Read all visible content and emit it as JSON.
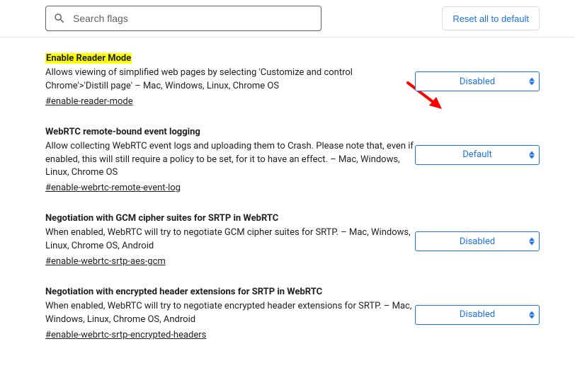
{
  "header": {
    "search_placeholder": "Search flags",
    "reset_label": "Reset all to default"
  },
  "flags": [
    {
      "title": "Enable Reader Mode",
      "highlight": true,
      "description": "Allows viewing of simplified web pages by selecting 'Customize and control Chrome'>'Distill page' – Mac, Windows, Linux, Chrome OS",
      "hash": "#enable-reader-mode",
      "select_value": "Disabled"
    },
    {
      "title": "WebRTC remote-bound event logging",
      "highlight": false,
      "description": "Allow collecting WebRTC event logs and uploading them to Crash. Please note that, even if enabled, this will still require a policy to be set, for it to have an effect. – Mac, Windows, Linux, Chrome OS",
      "hash": "#enable-webrtc-remote-event-log",
      "select_value": "Default"
    },
    {
      "title": "Negotiation with GCM cipher suites for SRTP in WebRTC",
      "highlight": false,
      "description": "When enabled, WebRTC will try to negotiate GCM cipher suites for SRTP. – Mac, Windows, Linux, Chrome OS, Android",
      "hash": "#enable-webrtc-srtp-aes-gcm",
      "select_value": "Disabled"
    },
    {
      "title": "Negotiation with encrypted header extensions for SRTP in WebRTC",
      "highlight": false,
      "description": "When enabled, WebRTC will try to negotiate encrypted header extensions for SRTP. – Mac, Windows, Linux, Chrome OS, Android",
      "hash": "#enable-webrtc-srtp-encrypted-headers",
      "select_value": "Disabled"
    }
  ]
}
